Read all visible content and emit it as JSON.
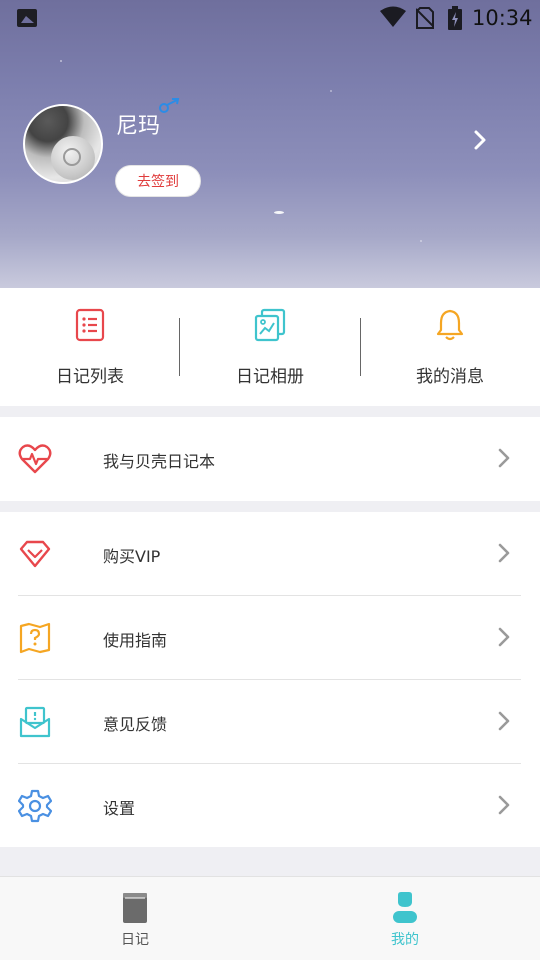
{
  "status_bar": {
    "time": "10:34",
    "icons": [
      "gallery-icon",
      "wifi-icon",
      "no-sim-icon",
      "battery-charging-icon"
    ]
  },
  "profile": {
    "username": "尼玛",
    "signin_label": "去签到",
    "gender_icon": "male-icon"
  },
  "quick_actions": [
    {
      "label": "日记列表",
      "icon": "list-icon",
      "color": "#e8474c"
    },
    {
      "label": "日记相册",
      "icon": "photo-album-icon",
      "color": "#3fc4cd"
    },
    {
      "label": "我的消息",
      "icon": "bell-icon",
      "color": "#f5a623"
    }
  ],
  "menu_group_1": [
    {
      "label": "我与贝壳日记本",
      "icon": "heart-pulse-icon",
      "color": "#e8474c"
    }
  ],
  "menu_group_2": [
    {
      "label": "购买VIP",
      "icon": "diamond-icon",
      "color": "#e8474c"
    },
    {
      "label": "使用指南",
      "icon": "guide-map-icon",
      "color": "#f5a623"
    },
    {
      "label": "意见反馈",
      "icon": "feedback-envelope-icon",
      "color": "#3fc4cd"
    },
    {
      "label": "设置",
      "icon": "settings-gear-icon",
      "color": "#4a90e2"
    }
  ],
  "bottom_nav": {
    "tabs": [
      {
        "label": "日记",
        "icon": "diary-book-icon",
        "active": false
      },
      {
        "label": "我的",
        "icon": "user-icon",
        "active": true
      }
    ],
    "active_color": "#3fc4cd",
    "inactive_color": "#555555"
  }
}
